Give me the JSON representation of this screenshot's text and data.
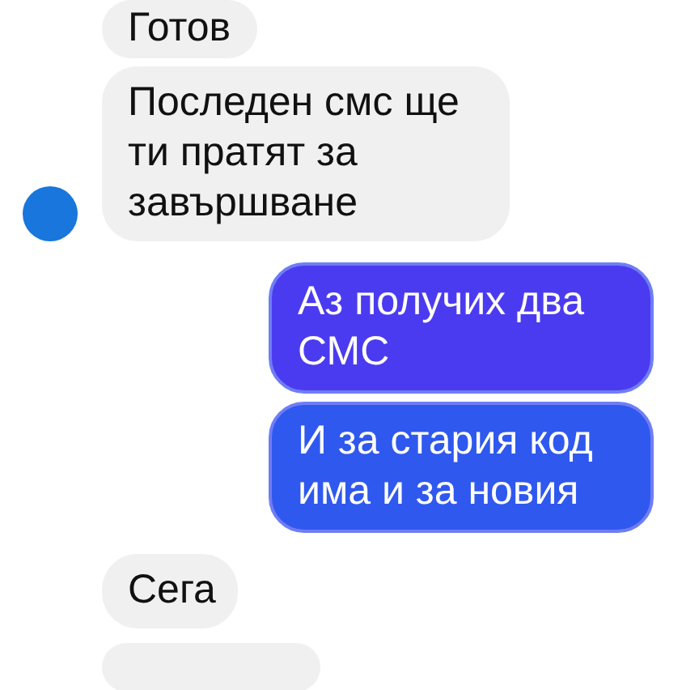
{
  "messages": [
    {
      "kind": "incoming",
      "text": "Готов",
      "avatar": false
    },
    {
      "kind": "incoming",
      "text": "Последен смс ще ти пратят за завършване",
      "avatar": true
    },
    {
      "kind": "outgoing",
      "text": "Аз получих два СМС",
      "avatar": false
    },
    {
      "kind": "outgoing",
      "text": "И за стария код има и за новия",
      "avatar": false
    },
    {
      "kind": "incoming",
      "text": "Сега",
      "avatar": false
    },
    {
      "kind": "incoming",
      "avatar": false
    }
  ]
}
